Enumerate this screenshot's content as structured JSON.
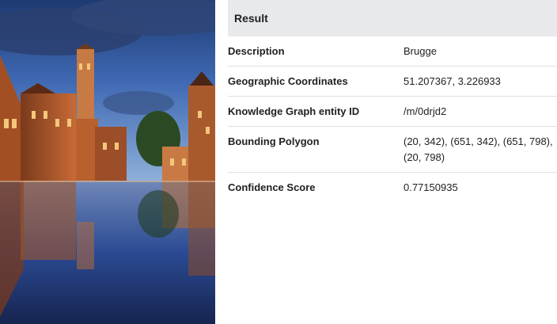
{
  "result": {
    "header": "Result",
    "rows": [
      {
        "label": "Description",
        "value": "Brugge"
      },
      {
        "label": "Geographic Coordinates",
        "value": "51.207367, 3.226933"
      },
      {
        "label": "Knowledge Graph entity ID",
        "value": "/m/0drjd2"
      },
      {
        "label": "Bounding Polygon",
        "value": "(20, 342), (651, 342), (651, 798), (20, 798)"
      },
      {
        "label": "Confidence Score",
        "value": "0.77150935"
      }
    ]
  },
  "photo": {
    "subject": "Bruges canal at dusk with belfry tower and reflections"
  }
}
